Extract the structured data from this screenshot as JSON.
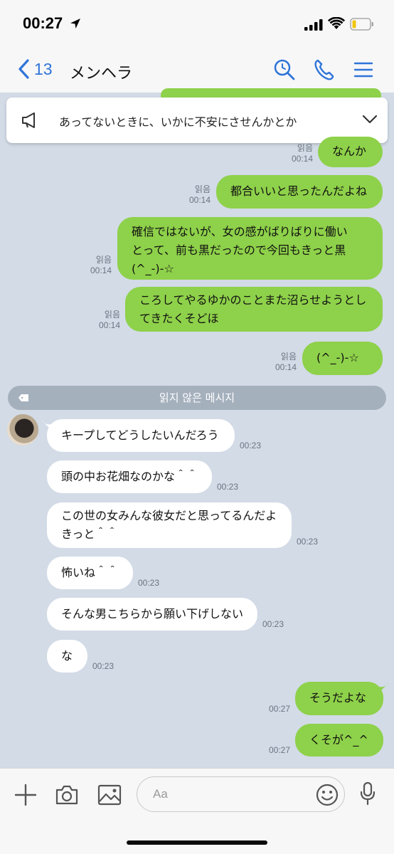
{
  "status": {
    "time": "00:27"
  },
  "header": {
    "back_count": "13",
    "title": "メンヘラ"
  },
  "notice": {
    "text": "あってないときに、いかに不安にさせんかとか"
  },
  "messages": {
    "m1": {
      "text": "なんか",
      "read": "읽음",
      "time": "00:14"
    },
    "m2": {
      "text": "都合いいと思ったんだよね",
      "read": "읽음",
      "time": "00:14"
    },
    "m3": {
      "text": "確信ではないが、女の感がばりばりに働い\nとって、前も黒だったので今回もきっと黒\n(^_-)-☆",
      "read": "읽음",
      "time": "00:14"
    },
    "m4": {
      "text": "ころしてやるゆかのことまた沼らせようとし\nてきたくそどほ",
      "read": "읽음",
      "time": "00:14"
    },
    "m5": {
      "text": "(^_-)-☆",
      "read": "읽음",
      "time": "00:14"
    },
    "unread_label": "읽지 않은 메시지",
    "i1": {
      "text": "キープしてどうしたいんだろう",
      "time": "00:23"
    },
    "i2": {
      "text": "頭の中お花畑なのかな＾＾",
      "time": "00:23"
    },
    "i3": {
      "text": "この世の女みんな彼女だと思ってるんだよ\nきっと＾＾",
      "time": "00:23"
    },
    "i4": {
      "text": "怖いね＾＾",
      "time": "00:23"
    },
    "i5": {
      "text": "そんな男こちらから願い下げしない",
      "time": "00:23"
    },
    "i6": {
      "text": "な",
      "time": "00:23"
    },
    "o1": {
      "text": "そうだよな",
      "time": "00:27"
    },
    "o2": {
      "text": "くそが^_^",
      "time": "00:27"
    }
  },
  "composer": {
    "placeholder": "Aa"
  },
  "colors": {
    "accent": "#2f74d8",
    "bubble_out": "#8ed14a",
    "background": "#d2dbe6"
  }
}
